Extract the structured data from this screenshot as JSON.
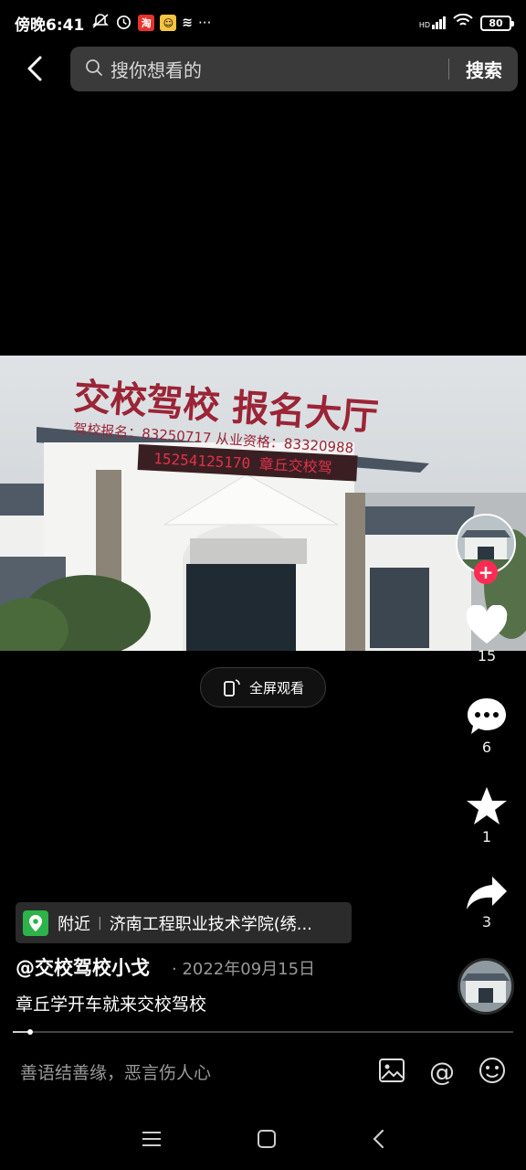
{
  "status_bar": {
    "time": "傍晚6:41",
    "badge_tao": "淘",
    "more": "···",
    "network": "HD",
    "battery": "80"
  },
  "search": {
    "placeholder": "搜你想看的",
    "button_label": "搜索"
  },
  "video": {
    "fullscreen_label": "全屏观看"
  },
  "actions": {
    "likes": "15",
    "comments": "6",
    "favorites": "1",
    "shares": "3"
  },
  "post": {
    "location_prefix": "附近",
    "location_name": "济南工程职业技术学院(绣...",
    "author": "@交校驾校小戈",
    "date": "· 2022年09月15日",
    "caption": "章丘学开车就来交校驾校",
    "progress": 0.035
  },
  "comment": {
    "placeholder": "善语结善缘，恶言伤人心"
  },
  "colors": {
    "accent_red": "#fe2c55",
    "location_green": "#2db34a"
  }
}
